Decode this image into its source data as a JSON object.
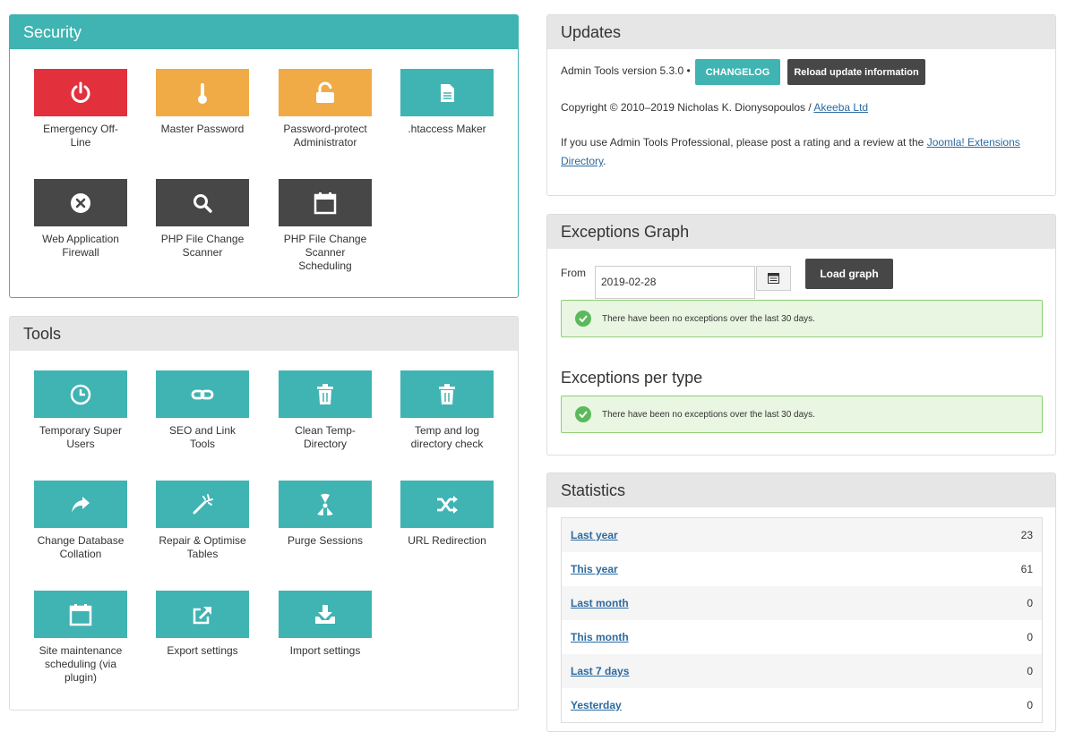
{
  "security": {
    "title": "Security",
    "tiles": [
      {
        "label": "Emergency Off-Line",
        "icon": "power-icon",
        "color": "#e2303d"
      },
      {
        "label": "Master Password",
        "icon": "thermometer-icon",
        "color": "#f0ab47"
      },
      {
        "label": "Password-protect Administrator",
        "icon": "unlock-icon",
        "color": "#f0ab47"
      },
      {
        "label": ".htaccess Maker",
        "icon": "file-icon",
        "color": "#40b3b3"
      },
      {
        "label": "Web Application Firewall",
        "icon": "close-circle-icon",
        "color": "#474747"
      },
      {
        "label": "PHP File Change Scanner",
        "icon": "search-icon",
        "color": "#474747"
      },
      {
        "label": "PHP File Change Scanner Scheduling",
        "icon": "calendar-icon",
        "color": "#474747"
      }
    ]
  },
  "tools": {
    "title": "Tools",
    "tiles": [
      {
        "label": "Temporary Super Users",
        "icon": "clock-icon"
      },
      {
        "label": "SEO and Link Tools",
        "icon": "link-icon"
      },
      {
        "label": "Clean Temp-Directory",
        "icon": "trash-icon"
      },
      {
        "label": "Temp and log directory check",
        "icon": "trash-icon"
      },
      {
        "label": "Change Database Collation",
        "icon": "share-arrow-icon"
      },
      {
        "label": "Repair & Optimise Tables",
        "icon": "magic-wand-icon"
      },
      {
        "label": "Purge Sessions",
        "icon": "radiation-icon"
      },
      {
        "label": "URL Redirection",
        "icon": "shuffle-icon"
      },
      {
        "label": "Site maintenance scheduling (via plugin)",
        "icon": "calendar-icon"
      },
      {
        "label": "Export settings",
        "icon": "export-icon"
      },
      {
        "label": "Import settings",
        "icon": "download-icon"
      }
    ]
  },
  "updates": {
    "title": "Updates",
    "version_text": "Admin Tools version 5.3.0 •",
    "changelog_label": "CHANGELOG",
    "reload_label": "Reload update information",
    "copyright_text": "Copyright © 2010–2019 Nicholas K. Dionysopoulos /",
    "copyright_link": "Akeeba Ltd",
    "rating_text": "If you use Admin Tools Professional, please post a rating and a review at the",
    "rating_link": "Joomla! Extensions Directory",
    "rating_end": "."
  },
  "exceptions": {
    "title": "Exceptions Graph",
    "from_label": "From",
    "from_value": "2019-02-28",
    "load_label": "Load graph",
    "alert_text": "There have been no exceptions over the last 30 days.",
    "per_type_title": "Exceptions per type",
    "per_type_alert": "There have been no exceptions over the last 30 days."
  },
  "statistics": {
    "title": "Statistics",
    "rows": [
      {
        "label": "Last year",
        "value": "23"
      },
      {
        "label": "This year",
        "value": "61"
      },
      {
        "label": "Last month",
        "value": "0"
      },
      {
        "label": "This month",
        "value": "0"
      },
      {
        "label": "Last 7 days",
        "value": "0"
      },
      {
        "label": "Yesterday",
        "value": "0"
      }
    ]
  }
}
